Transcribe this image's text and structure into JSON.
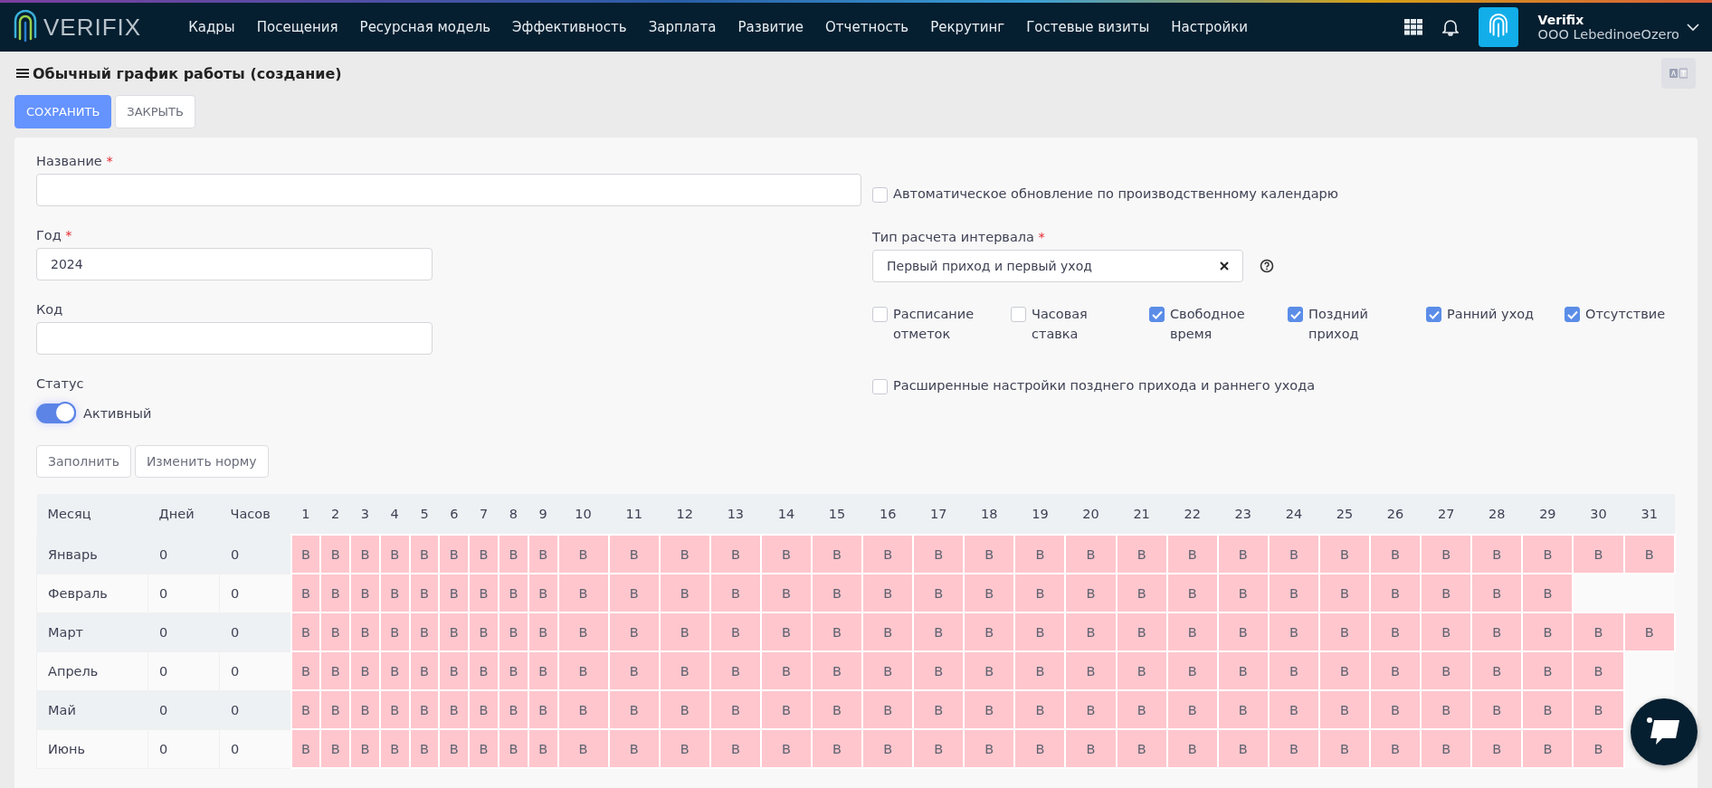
{
  "topbar": {
    "logo": "VERIFIX",
    "nav": [
      "Кадры",
      "Посещения",
      "Ресурсная модель",
      "Эффективность",
      "Зарплата",
      "Развитие",
      "Отчетность",
      "Рекрутинг",
      "Гостевые визиты",
      "Настройки"
    ],
    "user": {
      "name": "Verifix",
      "org": "OOO LebedinoeOzero"
    }
  },
  "page": {
    "title": "Обычный график работы (создание)"
  },
  "actions": [
    {
      "label": "СОХРАНИТЬ",
      "kind": "primary"
    },
    {
      "label": "ЗАКРЫТЬ",
      "kind": "default"
    }
  ],
  "form": {
    "name": {
      "label": "Название",
      "required_mark": "*"
    },
    "year": {
      "label": "Год",
      "required_mark": "*",
      "value": "2024"
    },
    "code": {
      "label": "Код"
    },
    "status": {
      "label": "Статус",
      "on": true,
      "text": "Активный"
    },
    "auto_update": {
      "label": "Автоматическое обновление по производственному календарю",
      "checked": false
    },
    "interval": {
      "label": "Тип расчета интервала",
      "required_mark": "*",
      "value": "Первый приход и первый уход"
    },
    "options": [
      {
        "label": "Расписание отметок",
        "checked": false
      },
      {
        "label": "Часовая ставка",
        "checked": false
      },
      {
        "label": "Свободное время",
        "checked": true
      },
      {
        "label": "Поздний приход",
        "checked": true
      },
      {
        "label": "Ранний уход",
        "checked": true
      },
      {
        "label": "Отсутствие",
        "checked": true
      }
    ],
    "advanced": {
      "label": "Расширенные настройки позднего прихода и раннего ухода",
      "checked": false
    }
  },
  "tools": [
    "Заполнить",
    "Изменить норму"
  ],
  "table": {
    "columns": [
      "Месяц",
      "Дней",
      "Часов",
      "1",
      "2",
      "3",
      "4",
      "5",
      "6",
      "7",
      "8",
      "9",
      "10",
      "11",
      "12",
      "13",
      "14",
      "15",
      "16",
      "17",
      "18",
      "19",
      "20",
      "21",
      "22",
      "23",
      "24",
      "25",
      "26",
      "27",
      "28",
      "29",
      "30",
      "31"
    ],
    "rows": [
      {
        "cells": [
          "Январь",
          "0",
          "0",
          "В",
          "В",
          "В",
          "В",
          "В",
          "В",
          "В",
          "В",
          "В",
          "В",
          "В",
          "В",
          "В",
          "В",
          "В",
          "В",
          "В",
          "В",
          "В",
          "В",
          "В",
          "В",
          "В",
          "В",
          "В",
          "В",
          "В",
          "В",
          "В",
          "В",
          "В"
        ]
      },
      {
        "cells": [
          "Февраль",
          "0",
          "0",
          "В",
          "В",
          "В",
          "В",
          "В",
          "В",
          "В",
          "В",
          "В",
          "В",
          "В",
          "В",
          "В",
          "В",
          "В",
          "В",
          "В",
          "В",
          "В",
          "В",
          "В",
          "В",
          "В",
          "В",
          "В",
          "В",
          "В",
          "В",
          "В"
        ]
      },
      {
        "cells": [
          "Март",
          "0",
          "0",
          "В",
          "В",
          "В",
          "В",
          "В",
          "В",
          "В",
          "В",
          "В",
          "В",
          "В",
          "В",
          "В",
          "В",
          "В",
          "В",
          "В",
          "В",
          "В",
          "В",
          "В",
          "В",
          "В",
          "В",
          "В",
          "В",
          "В",
          "В",
          "В",
          "В",
          "В"
        ]
      },
      {
        "cells": [
          "Апрель",
          "0",
          "0",
          "В",
          "В",
          "В",
          "В",
          "В",
          "В",
          "В",
          "В",
          "В",
          "В",
          "В",
          "В",
          "В",
          "В",
          "В",
          "В",
          "В",
          "В",
          "В",
          "В",
          "В",
          "В",
          "В",
          "В",
          "В",
          "В",
          "В",
          "В",
          "В",
          "В"
        ]
      },
      {
        "cells": [
          "Май",
          "0",
          "0",
          "В",
          "В",
          "В",
          "В",
          "В",
          "В",
          "В",
          "В",
          "В",
          "В",
          "В",
          "В",
          "В",
          "В",
          "В",
          "В",
          "В",
          "В",
          "В",
          "В",
          "В",
          "В",
          "В",
          "В",
          "В",
          "В",
          "В",
          "В",
          "В",
          "В"
        ]
      },
      {
        "cells": [
          "Июнь",
          "0",
          "0",
          "В",
          "В",
          "В",
          "В",
          "В",
          "В",
          "В",
          "В",
          "В",
          "В",
          "В",
          "В",
          "В",
          "В",
          "В",
          "В",
          "В",
          "В",
          "В",
          "В",
          "В",
          "В",
          "В",
          "В",
          "В",
          "В",
          "В",
          "В",
          "В",
          "В"
        ]
      }
    ]
  }
}
